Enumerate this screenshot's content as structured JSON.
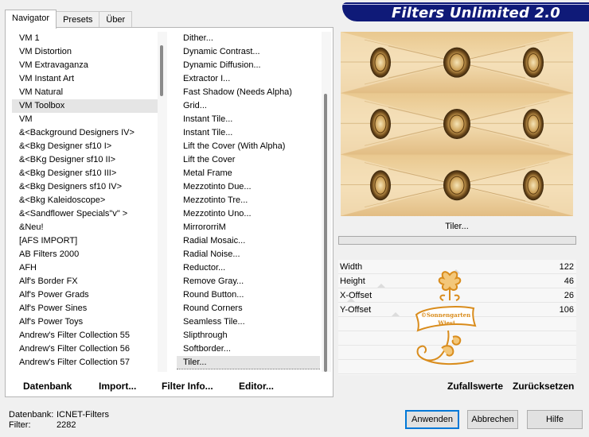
{
  "tabs": [
    {
      "label": "Navigator"
    },
    {
      "label": "Presets"
    },
    {
      "label": "Über"
    }
  ],
  "banner_title": "Filters Unlimited 2.0",
  "categories": [
    "VM 1",
    "VM Distortion",
    "VM Extravaganza",
    "VM Instant Art",
    "VM Natural",
    "VM Toolbox",
    "VM",
    "&<Background Designers IV>",
    "&<Bkg Designer sf10 I>",
    "&<BKg Designer sf10 II>",
    "&<Bkg Designer sf10 III>",
    "&<Bkg Designers sf10 IV>",
    "&<Bkg Kaleidoscope>",
    "&<Sandflower Specials\"v\" >",
    "&Neu!",
    "[AFS IMPORT]",
    "AB Filters 2000",
    "AFH",
    "Alf's Border FX",
    "Alf's Power Grads",
    "Alf's Power Sines",
    "Alf's Power Toys",
    "Andrew's Filter Collection 55",
    "Andrew's Filter Collection 56",
    "Andrew's Filter Collection 57"
  ],
  "selected_category": "VM Toolbox",
  "filters": [
    "Dither...",
    "Dynamic Contrast...",
    "Dynamic Diffusion...",
    "Extractor I...",
    "Fast Shadow (Needs Alpha)",
    "Grid...",
    "Instant Tile...",
    "Instant Tile...",
    "Lift the Cover (With Alpha)",
    "Lift the Cover",
    "Metal Frame",
    "Mezzotinto Due...",
    "Mezzotinto Tre...",
    "Mezzotinto Uno...",
    "MirrororriM",
    "Radial Mosaic...",
    "Radial Noise...",
    "Reductor...",
    "Remove Gray...",
    "Round Button...",
    "Round Corners",
    "Seamless Tile...",
    "Slipthrough",
    "Softborder...",
    "Tiler..."
  ],
  "selected_filter": "Tiler...",
  "list_buttons": {
    "datenbank": "Datenbank",
    "import": "Import...",
    "filter_info": "Filter Info...",
    "editor": "Editor..."
  },
  "preview_label": "Tiler...",
  "params": [
    {
      "name": "Width",
      "value": "122"
    },
    {
      "name": "Height",
      "value": "46"
    },
    {
      "name": "X-Offset",
      "value": "26"
    },
    {
      "name": "Y-Offset",
      "value": "106"
    }
  ],
  "watermark_text_1": "©Sonnengarten",
  "watermark_text_2": "Wiesi",
  "right_buttons": {
    "random": "Zufallswerte",
    "reset": "Zurücksetzen"
  },
  "footer": {
    "db_label": "Datenbank:",
    "db_value": "ICNET-Filters",
    "filter_label": "Filter:",
    "filter_value": "2282"
  },
  "dialog_buttons": {
    "apply": "Anwenden",
    "cancel": "Abbrechen",
    "help": "Hilfe"
  },
  "colors": {
    "banner": "#0f1a78",
    "watermark": "#d98c1c",
    "default_button_border": "#0078d7"
  }
}
